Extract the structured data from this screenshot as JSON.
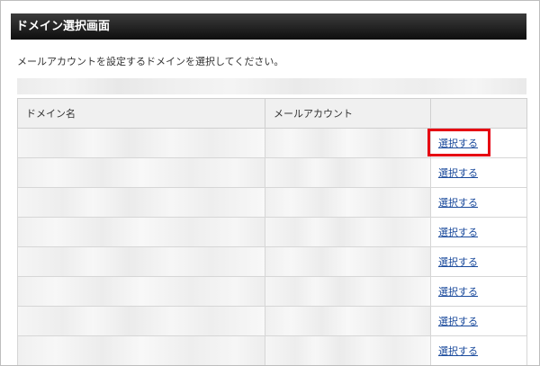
{
  "page": {
    "title": "ドメイン選択画面",
    "description": "メールアカウントを設定するドメインを選択してください。"
  },
  "table": {
    "headers": {
      "domain": "ドメイン名",
      "mail_account": "メールアカウント",
      "action": ""
    },
    "rows": [
      {
        "select_label": "選択する"
      },
      {
        "select_label": "選択する"
      },
      {
        "select_label": "選択する"
      },
      {
        "select_label": "選択する"
      },
      {
        "select_label": "選択する"
      },
      {
        "select_label": "選択する"
      },
      {
        "select_label": "選択する"
      },
      {
        "select_label": "選択する"
      }
    ]
  },
  "colors": {
    "highlight": "#e60012",
    "link": "#1a4a9c",
    "title_bar": "#1a1a1a"
  }
}
